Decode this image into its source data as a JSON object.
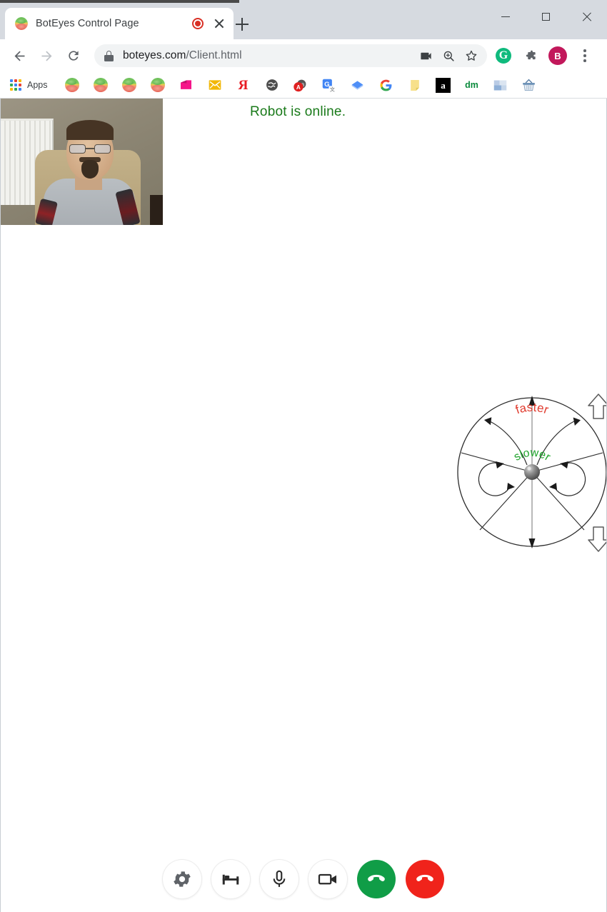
{
  "window": {
    "controls": [
      {
        "name": "minimize",
        "label": "Minimize"
      },
      {
        "name": "maximize",
        "label": "Maximize"
      },
      {
        "name": "close",
        "label": "Close"
      }
    ]
  },
  "tabstrip": {
    "tab": {
      "title": "BotEyes Control Page",
      "favicon": "boteyes-logo-icon",
      "recording_indicator": "record-dot-icon",
      "close_icon": "close-icon"
    },
    "new_tab_icon": "plus-icon"
  },
  "toolbar": {
    "back_icon": "arrow-back-icon",
    "forward_icon": "arrow-forward-icon",
    "reload_icon": "reload-icon",
    "lock_icon": "lock-icon",
    "url_domain": "boteyes.com",
    "url_path": "/Client.html",
    "url_full": "boteyes.com/Client.html",
    "media_icon": "video-camera-icon",
    "zoom_icon": "zoom-in-icon",
    "bookmark_icon": "star-icon",
    "grammarly_letter": "G",
    "extensions_icon": "puzzle-piece-icon",
    "profile_letter": "B",
    "menu_icon": "kebab-menu-icon",
    "accent_green": "#0fba7d",
    "accent_avatar": "#c2185b"
  },
  "bookmarks": {
    "apps_label": "Apps",
    "apps_icon": "apps-grid-icon",
    "overflow_icon": "chevron-right-icon",
    "items": [
      {
        "name": "boteyes-bookmark-1",
        "icon": "boteyes-logo-icon"
      },
      {
        "name": "boteyes-bookmark-2",
        "icon": "boteyes-logo-icon"
      },
      {
        "name": "boteyes-bookmark-3",
        "icon": "boteyes-logo-icon"
      },
      {
        "name": "boteyes-bookmark-4",
        "icon": "boteyes-logo-icon"
      },
      {
        "name": "pink-folder-bookmark",
        "icon": "folder-icon"
      },
      {
        "name": "mail-bookmark",
        "icon": "envelope-icon"
      },
      {
        "name": "yandex-bookmark",
        "icon": "yandex-icon",
        "letter": "Я"
      },
      {
        "name": "globe-bookmark",
        "icon": "globe-icon"
      },
      {
        "name": "adblock-bookmark",
        "icon": "adblock-icon",
        "letter": "A"
      },
      {
        "name": "google-translate-bookmark",
        "icon": "translate-icon",
        "letter": "G"
      },
      {
        "name": "diamond-bookmark",
        "icon": "diamond-icon"
      },
      {
        "name": "google-bookmark",
        "icon": "google-g-icon",
        "letter": "G"
      },
      {
        "name": "notes-bookmark",
        "icon": "sticky-note-icon"
      },
      {
        "name": "amazon-bookmark",
        "icon": "amazon-icon",
        "letter": "a"
      },
      {
        "name": "dm-bookmark",
        "icon": "dm-icon",
        "letter": "dm"
      },
      {
        "name": "squares-bookmark",
        "icon": "squares-icon"
      },
      {
        "name": "basket-bookmark",
        "icon": "shopping-basket-icon"
      }
    ]
  },
  "page": {
    "status_text": "Robot is online.",
    "status_color": "#1a7a1a",
    "video_preview": {
      "name": "local-video-preview",
      "alt": "Live webcam feed of a man seated in a room"
    }
  },
  "joystick": {
    "name": "robot-drive-joystick",
    "faster_label": "faster",
    "faster_color": "#e03b2e",
    "slower_label": "slower",
    "slower_color": "#1fa32b",
    "up_arrow_icon": "arrow-up-outline-icon",
    "down_arrow_icon": "arrow-down-outline-icon",
    "knob_icon": "joystick-knob-icon"
  },
  "callbar": {
    "buttons": [
      {
        "name": "settings-button",
        "icon": "gear-icon",
        "style": "light"
      },
      {
        "name": "lie-down-button",
        "icon": "bed-icon",
        "style": "light"
      },
      {
        "name": "microphone-button",
        "icon": "microphone-icon",
        "style": "light"
      },
      {
        "name": "camera-button",
        "icon": "video-camera-icon",
        "style": "light"
      },
      {
        "name": "answer-call-button",
        "icon": "phone-icon",
        "style": "green"
      },
      {
        "name": "end-call-button",
        "icon": "phone-hangup-icon",
        "style": "red"
      }
    ],
    "green_color": "#109d47",
    "red_color": "#f0231b"
  }
}
